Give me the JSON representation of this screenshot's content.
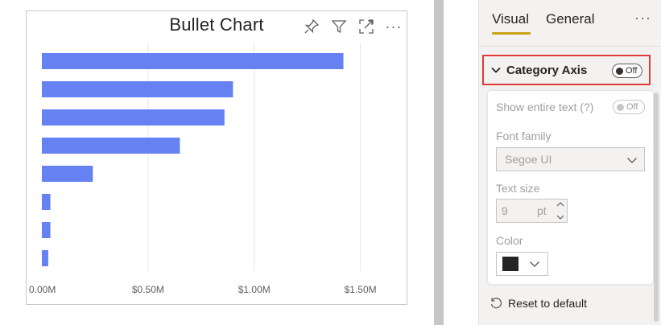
{
  "visual": {
    "title": "Bullet Chart",
    "toolbar": {
      "pin_icon": "pin-icon",
      "filter_icon": "filter-icon",
      "focus_icon": "focus-mode-icon",
      "more_icon": "more-options-icon",
      "more_glyph": "···"
    }
  },
  "chart_data": {
    "type": "bar",
    "orientation": "horizontal",
    "title": "Bullet Chart",
    "categories": [
      "",
      "",
      "",
      "",
      "",
      "",
      "",
      ""
    ],
    "values": [
      1.42,
      0.9,
      0.86,
      0.65,
      0.24,
      0.04,
      0.04,
      0.03
    ],
    "x_tick_values": [
      0,
      0.5,
      1.0,
      1.5
    ],
    "x_tick_labels": [
      "0.00M",
      "$0.50M",
      "$1.00M",
      "$1.50M"
    ],
    "xlim": [
      0,
      1.6
    ],
    "grid": true,
    "bar_color": "#6581f2",
    "grid_color": "#e6e6e6"
  },
  "pane": {
    "tabs": [
      {
        "label": "Visual",
        "active": true
      },
      {
        "label": "General",
        "active": false
      }
    ],
    "more_glyph": "···",
    "category_axis": {
      "label": "Category Axis",
      "toggle_text": "Off"
    },
    "settings": {
      "show_entire_text_label": "Show entire text (?)",
      "show_entire_text_toggle": "Off",
      "font_family_label": "Font family",
      "font_family_value": "Segoe UI",
      "text_size_label": "Text size",
      "text_size_value": "9",
      "text_size_unit": "pt",
      "color_label": "Color",
      "color_value": "#252423"
    },
    "reset_label": "Reset to default"
  }
}
